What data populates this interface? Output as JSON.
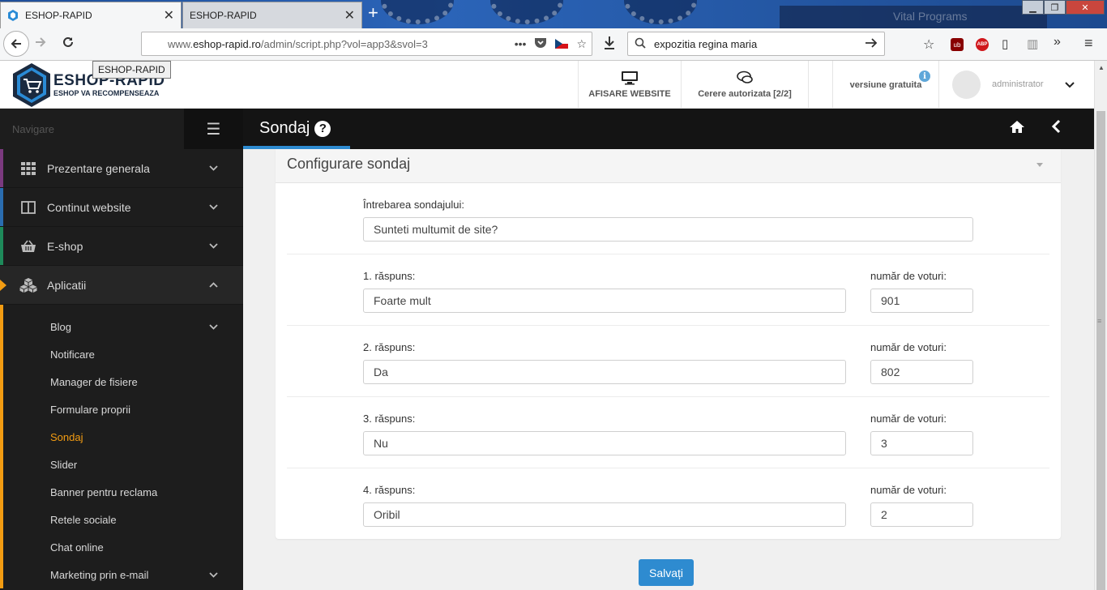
{
  "browser": {
    "tabs": [
      {
        "title": "ESHOP-RAPID",
        "active": true
      },
      {
        "title": "ESHOP-RAPID",
        "active": false
      }
    ],
    "url_prefix": "www.",
    "url_domain": "eshop-rapid.ro",
    "url_path": "/admin/script.php?vol=app3&svol=3",
    "tooltip": "ESHOP-RAPID",
    "search_query": "expozitia regina maria",
    "background_text": "Vital Programs"
  },
  "header": {
    "logo_title": "ESHOP-RAPID",
    "logo_tagline": "ESHOP VA RECOMPENSEAZA",
    "view_website": "AFISARE WEBSITE",
    "auth_requests": "Cerere autorizata [2/2]",
    "version": "versiune gratuita",
    "user": "administrator"
  },
  "sidebar": {
    "nav_label": "Navigare",
    "items": [
      {
        "label": "Prezentare generala",
        "icon": "grid-icon",
        "color": "#7b3a7f"
      },
      {
        "label": "Continut website",
        "icon": "columns-icon",
        "color": "#2a6db0"
      },
      {
        "label": "E-shop",
        "icon": "basket-icon",
        "color": "#1e8a5a"
      },
      {
        "label": "Aplicatii",
        "icon": "cubes-icon",
        "color": "#f39c12"
      }
    ],
    "subitems": [
      "Blog",
      "Notificare",
      "Manager de fisiere",
      "Formulare proprii",
      "Sondaj",
      "Slider",
      "Banner pentru reclama",
      "Retele sociale",
      "Chat online",
      "Marketing prin e-mail"
    ]
  },
  "page": {
    "title": "Sondaj",
    "panel_title": "Configurare sondaj",
    "question_label": "Întrebarea sondajului:",
    "question_value": "Sunteti multumit de site?",
    "votes_label": "număr de voturi:",
    "answers": [
      {
        "label": "1. răspuns:",
        "value": "Foarte mult",
        "votes": "901"
      },
      {
        "label": "2. răspuns:",
        "value": "Da",
        "votes": "802"
      },
      {
        "label": "3. răspuns:",
        "value": "Nu",
        "votes": "3"
      },
      {
        "label": "4. răspuns:",
        "value": "Oribil",
        "votes": "2"
      }
    ],
    "save_label": "Salvați"
  },
  "colors": {
    "accent": "#2e8bd0",
    "sidebar_bg": "#1d1d1d",
    "highlight": "#f39c12"
  }
}
